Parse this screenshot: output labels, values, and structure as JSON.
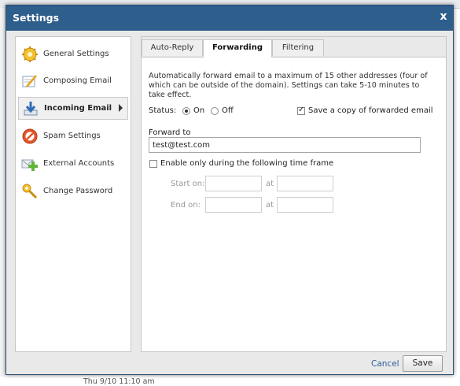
{
  "background": {
    "bottom_text": "Thu 9/10 11:10 am"
  },
  "dialog": {
    "title": "Settings",
    "close_label": "x"
  },
  "sidebar": {
    "items": [
      {
        "label": "General Settings",
        "icon": "gear-icon"
      },
      {
        "label": "Composing Email",
        "icon": "compose-icon"
      },
      {
        "label": "Incoming Email",
        "icon": "incoming-arrow-icon",
        "active": true
      },
      {
        "label": "Spam Settings",
        "icon": "no-entry-icon"
      },
      {
        "label": "External Accounts",
        "icon": "add-account-icon"
      },
      {
        "label": "Change Password",
        "icon": "key-icon"
      }
    ]
  },
  "tabs": [
    {
      "label": "Auto-Reply"
    },
    {
      "label": "Forwarding",
      "active": true
    },
    {
      "label": "Filtering"
    }
  ],
  "forwarding": {
    "description": "Automatically forward email to a maximum of 15 other addresses (four of which can be outside of the domain). Settings can take 5-10 minutes to take effect.",
    "status_label": "Status:",
    "status_on_label": "On",
    "status_off_label": "Off",
    "status_value": "On",
    "save_copy_label": "Save a copy of forwarded email",
    "save_copy_checked": true,
    "forward_to_label": "Forward to",
    "forward_to_value": "test@test.com",
    "time_frame_label": "Enable only during the following time frame",
    "time_frame_checked": false,
    "start_on_label": "Start on:",
    "end_on_label": "End on:",
    "at_label": "at"
  },
  "footer": {
    "cancel_label": "Cancel",
    "save_label": "Save"
  },
  "colors": {
    "titlebar": "#2e5e8c",
    "link": "#2a5e9c"
  }
}
